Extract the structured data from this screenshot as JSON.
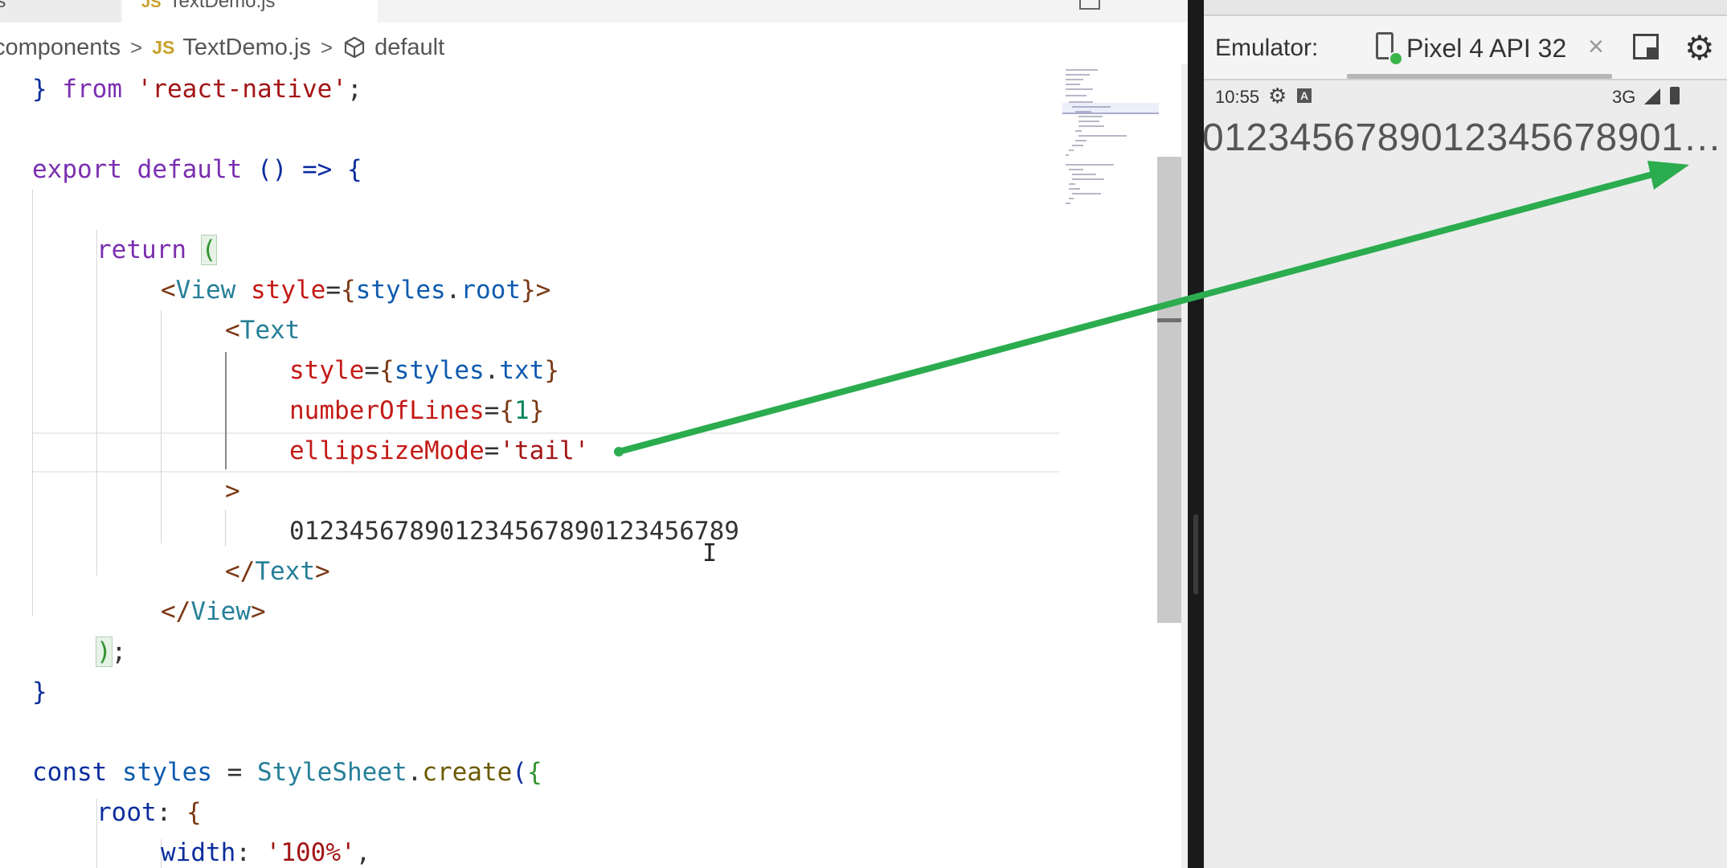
{
  "editor": {
    "tabs": {
      "previous_label": "js",
      "active_label": "TextDemo.js",
      "active_lang_badge": "JS"
    },
    "breadcrumb": {
      "folder": "components",
      "file_badge": "JS",
      "file": "TextDemo.js",
      "symbol": "default",
      "separator": ">"
    },
    "code": {
      "l1_close": "}",
      "l1_from": "from",
      "l1_module": "'react-native'",
      "l1_semi": ";",
      "l3_export": "export",
      "l3_default": "default",
      "l3_parens": "()",
      "l3_arrow": "=>",
      "l3_open": "{",
      "l5_return": "return",
      "l5_paren": "(",
      "l6_lt": "<",
      "l6_tag": "View",
      "l6_attr": "style",
      "l6_eq": "=",
      "l6_ob": "{",
      "l6_obj": "styles",
      "l6_dot": ".",
      "l6_prop": "root",
      "l6_cb": "}",
      "l6_gt": ">",
      "l7_lt": "<",
      "l7_tag": "Text",
      "l8_attr": "style",
      "l8_eq": "=",
      "l8_ob": "{",
      "l8_obj": "styles",
      "l8_dot": ".",
      "l8_prop": "txt",
      "l8_cb": "}",
      "l9_attr": "numberOfLines",
      "l9_eq": "=",
      "l9_ob": "{",
      "l9_num": "1",
      "l9_cb": "}",
      "l10_attr": "ellipsizeMode",
      "l10_eq": "=",
      "l10_val": "'tail'",
      "l11_gt": ">",
      "l12_text": "012345678901234567890123456789",
      "l13_open": "</",
      "l13_tag": "Text",
      "l13_gt": ">",
      "l14_open": "</",
      "l14_tag": "View",
      "l14_gt": ">",
      "l15_paren": ")",
      "l15_semi": ";",
      "l16_close": "}",
      "l18_const": "const",
      "l18_var": "styles",
      "l18_eq": "=",
      "l18_cls": "StyleSheet",
      "l18_dot": ".",
      "l18_fn": "create",
      "l18_paren": "(",
      "l18_brace": "{",
      "l19_key": "root",
      "l19_colon": ":",
      "l19_brace": "{",
      "l20_key": "width",
      "l20_colon": ":",
      "l20_val": "'100%'",
      "l20_comma": ","
    }
  },
  "emulator": {
    "label": "Emulator:",
    "device_tab": "Pixel 4 API 32",
    "close_glyph": "×",
    "gear_glyph": "⚙",
    "icons": [
      "device-icon",
      "close-icon",
      "dock-icon",
      "gear-icon"
    ],
    "status": {
      "time": "10:55",
      "gear_glyph": "⚙",
      "a_badge": "A",
      "network": "3G"
    },
    "app_text": "0123456789012345678901…"
  },
  "annotation": {
    "arrow_color": "#2bac4f"
  }
}
